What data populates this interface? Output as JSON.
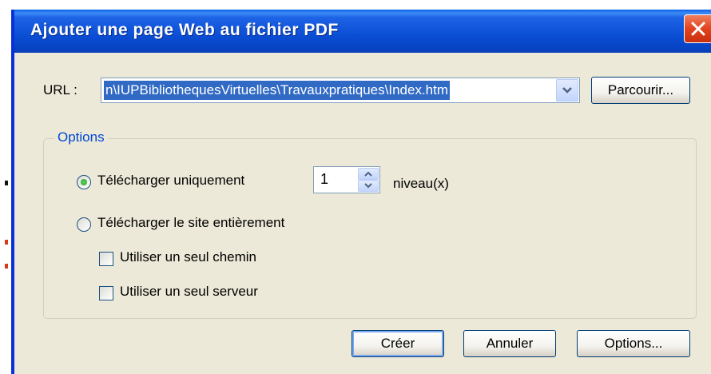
{
  "window": {
    "title": "Ajouter une page Web au fichier PDF",
    "close_icon": "close-icon"
  },
  "url": {
    "label": "URL :",
    "value": "n\\IUPBibliothequesVirtuelles\\Travauxpratiques\\Index.htm",
    "dropdown_icon": "chevron-down-icon",
    "browse_label": "Parcourir..."
  },
  "options_group": {
    "legend": "Options",
    "download_only": {
      "label": "Télécharger uniquement",
      "selected": true
    },
    "levels": {
      "value": "1",
      "unit_label": "niveau(x)"
    },
    "download_all": {
      "label": "Télécharger le site entièrement",
      "selected": false
    },
    "single_path": {
      "label": "Utiliser un seul chemin",
      "checked": false
    },
    "single_server": {
      "label": "Utiliser un seul serveur",
      "checked": false
    }
  },
  "buttons": {
    "create": "Créer",
    "cancel": "Annuler",
    "options": "Options..."
  },
  "colors": {
    "title_bar": "#0a4ed4",
    "dialog_bg": "#ece9d8",
    "legend_text": "#0046d5",
    "selection": "#316ac5",
    "close_button": "#e2431e"
  }
}
